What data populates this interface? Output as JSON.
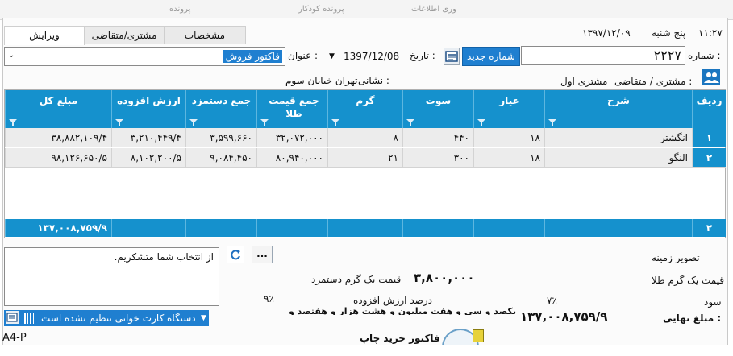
{
  "topbar": {
    "menu_center": "پرونده کودکار",
    "menu_right": "وری اطلاعات",
    "menu_left": "پرونده"
  },
  "datetime": {
    "time": "۱۱:۲۷",
    "day": "پنج شنبه",
    "date": "۱۳۹۷/۱۲/۰۹"
  },
  "tabs": {
    "edit": "ویرایش",
    "customer": "مشتری/متقاضی",
    "specs": "مشخصات"
  },
  "form": {
    "number_label": "شماره :",
    "number_value": "۲۲۲۷",
    "new_number_button": "شماره جدید",
    "date_label": "تاریخ :",
    "date_value": "1397/12/08",
    "title_label": "عنوان :",
    "title_value": "فاکتور فروش",
    "customer_label": "مشتری / متقاضی :",
    "customer_value": "مشتری اول",
    "address_label": "نشانی :",
    "address_value": "تهران خیابان سوم"
  },
  "table": {
    "headers": {
      "row": "ردیف",
      "desc": "شرح",
      "ayar": "عیار",
      "sut": "سوت",
      "gram": "گرم",
      "gold_total": "جمع قیمت طلا",
      "wage_total": "جمع دستمزد",
      "vat": "ارزش افزوده",
      "total": "مبلغ کل"
    },
    "rows": [
      {
        "row": "۱",
        "desc": "انگشتر",
        "ayar": "۱۸",
        "sut": "۴۴۰",
        "gram": "۸",
        "gold_total": "۳۲,۰۷۲,۰۰۰",
        "wage_total": "۳,۵۹۹,۶۶۰",
        "vat": "۳,۲۱۰,۴۴۹/۴",
        "total": "۳۸,۸۸۲,۱۰۹/۴"
      },
      {
        "row": "۲",
        "desc": "النگو",
        "ayar": "۱۸",
        "sut": "۳۰۰",
        "gram": "۲۱",
        "gold_total": "۸۰,۹۴۰,۰۰۰",
        "wage_total": "۹,۰۸۴,۴۵۰",
        "vat": "۸,۱۰۲,۲۰۰/۵",
        "total": "۹۸,۱۲۶,۶۵۰/۵"
      }
    ],
    "footer_count": "۲",
    "footer_total": "۱۳۷,۰۰۸,۷۵۹/۹"
  },
  "bottom": {
    "memo_text": "از انتخاب شما متشکریم.",
    "more_button": "...",
    "bg_image_label": "تصویر زمینه",
    "gold_price_label": "قیمت یک گرم طلا",
    "wage_price_label": "قیمت یک گرم دستمزد",
    "wage_price_value": "۳,۸۰۰,۰۰۰",
    "profit_label": "سود",
    "profit_value": "۷٪",
    "vat_percent_label": "درصد ارزش افزوده",
    "vat_percent_value": "۹٪",
    "amount_words": "یکصد و سی و هفت میلیون و هشت هزار و هفتصد و",
    "final_label": "مبلغ نهایی :",
    "final_value": "۱۳۷,۰۰۸,۷۵۹/۹",
    "scanner_status": "دستگاه کارت خوانی تنظیم نشده است",
    "print_label": "فاکتور خرید چاپ",
    "paper_size": "A4-P"
  }
}
